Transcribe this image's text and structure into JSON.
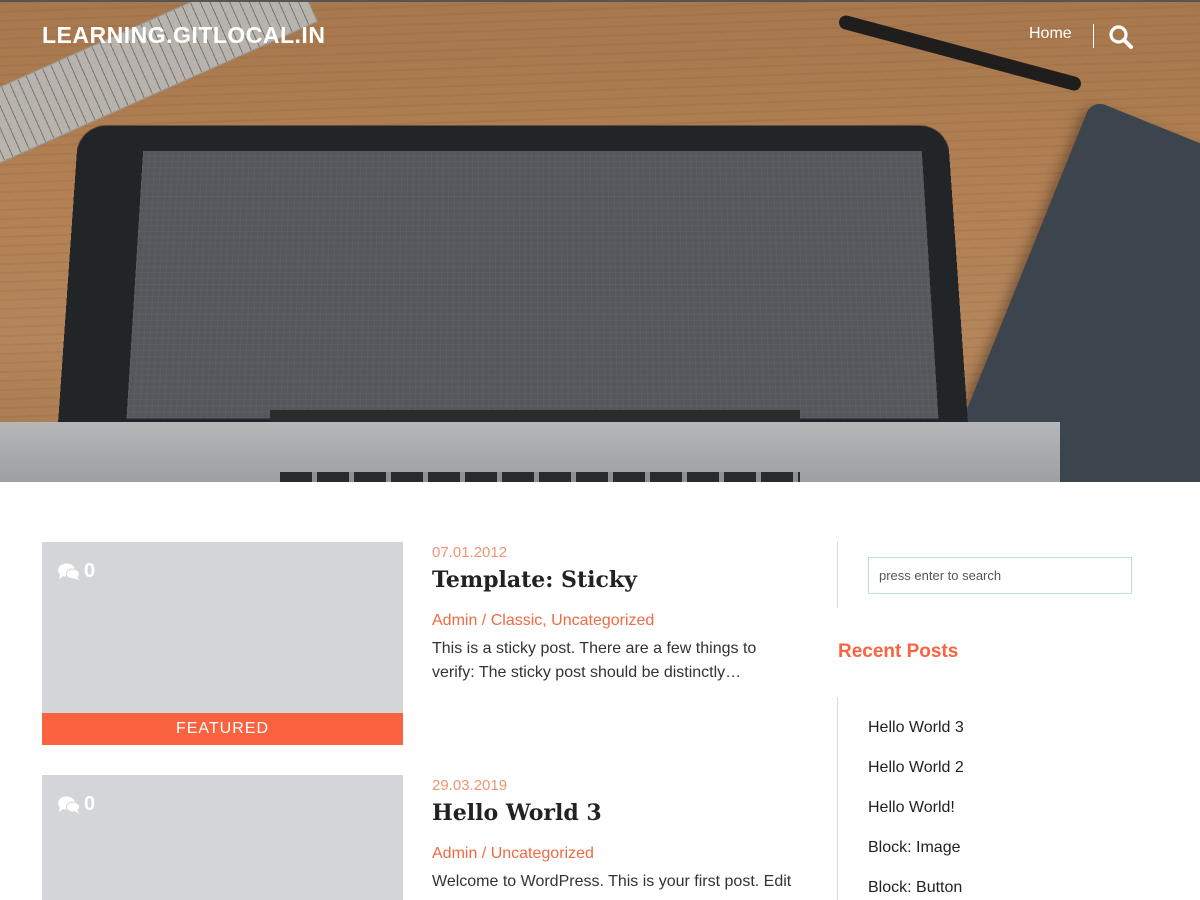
{
  "header": {
    "site_title": "LEARNING.GITLOCAL.IN",
    "nav": {
      "home_label": "Home"
    },
    "search_icon": "search-icon"
  },
  "posts": [
    {
      "comment_count": "0",
      "featured_label": "FEATURED",
      "date": "07.01.2012",
      "title": "Template: Sticky",
      "author": "Admin",
      "separator": " / ",
      "categories": "Classic, Uncategorized",
      "excerpt": "This is a sticky post. There are a few things to verify: The sticky post should be distinctly…"
    },
    {
      "comment_count": "0",
      "date": "29.03.2019",
      "title": "Hello World 3",
      "author": "Admin",
      "separator": " / ",
      "categories": "Uncategorized",
      "excerpt": "Welcome to WordPress. This is your first post. Edit"
    }
  ],
  "sidebar": {
    "search_placeholder": "press enter to search",
    "recent_posts_title": "Recent Posts",
    "recent_posts": [
      "Hello World 3",
      "Hello World 2",
      "Hello World!",
      "Block: Image",
      "Block: Button"
    ]
  },
  "colors": {
    "accent": "#fb6340",
    "date": "#f39373",
    "thumbnail_bg": "#d3d5d8"
  }
}
